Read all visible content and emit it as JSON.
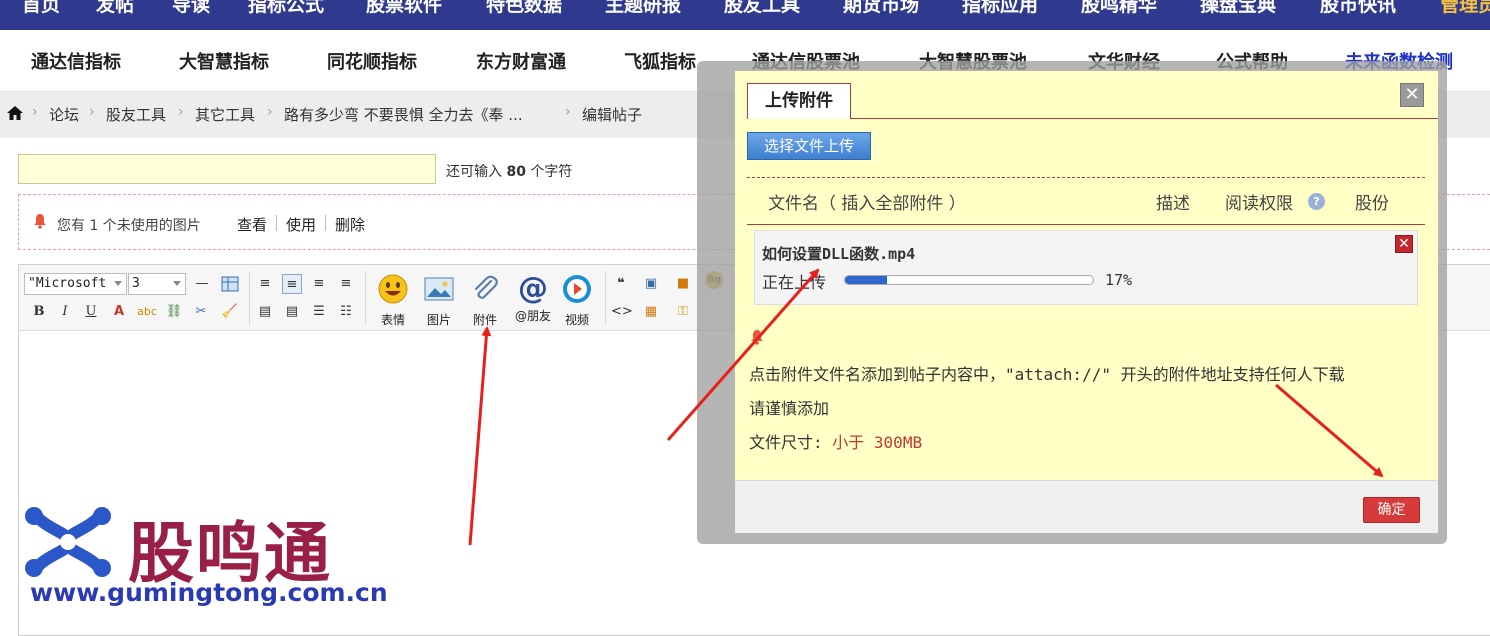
{
  "top_nav": {
    "items": [
      "首页",
      "发帖",
      "导读",
      "指标公式",
      "股票软件",
      "特色数据",
      "主题研报",
      "股友工具",
      "期货市场",
      "指标应用",
      "股鸣精华",
      "操盘宝典",
      "股市快讯",
      "管理员"
    ]
  },
  "sub_nav": {
    "items": [
      "通达信指标",
      "大智慧指标",
      "同花顺指标",
      "东方财富通",
      "飞狐指标",
      "通达信股票池",
      "大智慧股票池",
      "文华财经",
      "公式帮助",
      "未来函数检测"
    ]
  },
  "breadcrumb": {
    "items": [
      "论坛",
      "股友工具",
      "其它工具",
      "路有多少弯 不要畏惧 全力去《奉 ...",
      "编辑帖子"
    ]
  },
  "post": {
    "title_value": "",
    "remain_prefix": "还可输入",
    "remain_count": "80",
    "remain_suffix": "个字符"
  },
  "notice": {
    "text": "您有 1 个未使用的图片",
    "view": "查看",
    "use": "使用",
    "delete": "删除"
  },
  "editor": {
    "font_value": "\"Microsoft",
    "size_value": "3",
    "labels": {
      "emoji": "表情",
      "image": "图片",
      "attach": "附件",
      "mention": "@朋友",
      "video": "视频"
    }
  },
  "watermark": {
    "name": "股鸣通",
    "url": "www.gumingtong.com.cn"
  },
  "dialog": {
    "tab": "上传附件",
    "close": "✕",
    "upload_button": "选择文件上传",
    "columns": {
      "filename": "文件名（ 插入全部附件 ）",
      "desc": "描述",
      "permission": "阅读权限",
      "price": "股份"
    },
    "file": {
      "name": "如何设置DLL函数.mp4",
      "status": "正在上传",
      "progress": 0.17,
      "percent_text": "17%"
    },
    "info_line1": "点击附件文件名添加到帖子内容中，\"attach://\" 开头的附件地址支持任何人下载",
    "info_line2": "请谨慎添加",
    "size_label": "文件尺寸:",
    "size_value": "小于 300MB",
    "ok_button": "确定"
  },
  "colors": {
    "nav_bg": "#2f3a8f",
    "dialog_bg": "#ffffc6",
    "accent_red": "#d63a3a",
    "progress": "#2f66cf"
  }
}
